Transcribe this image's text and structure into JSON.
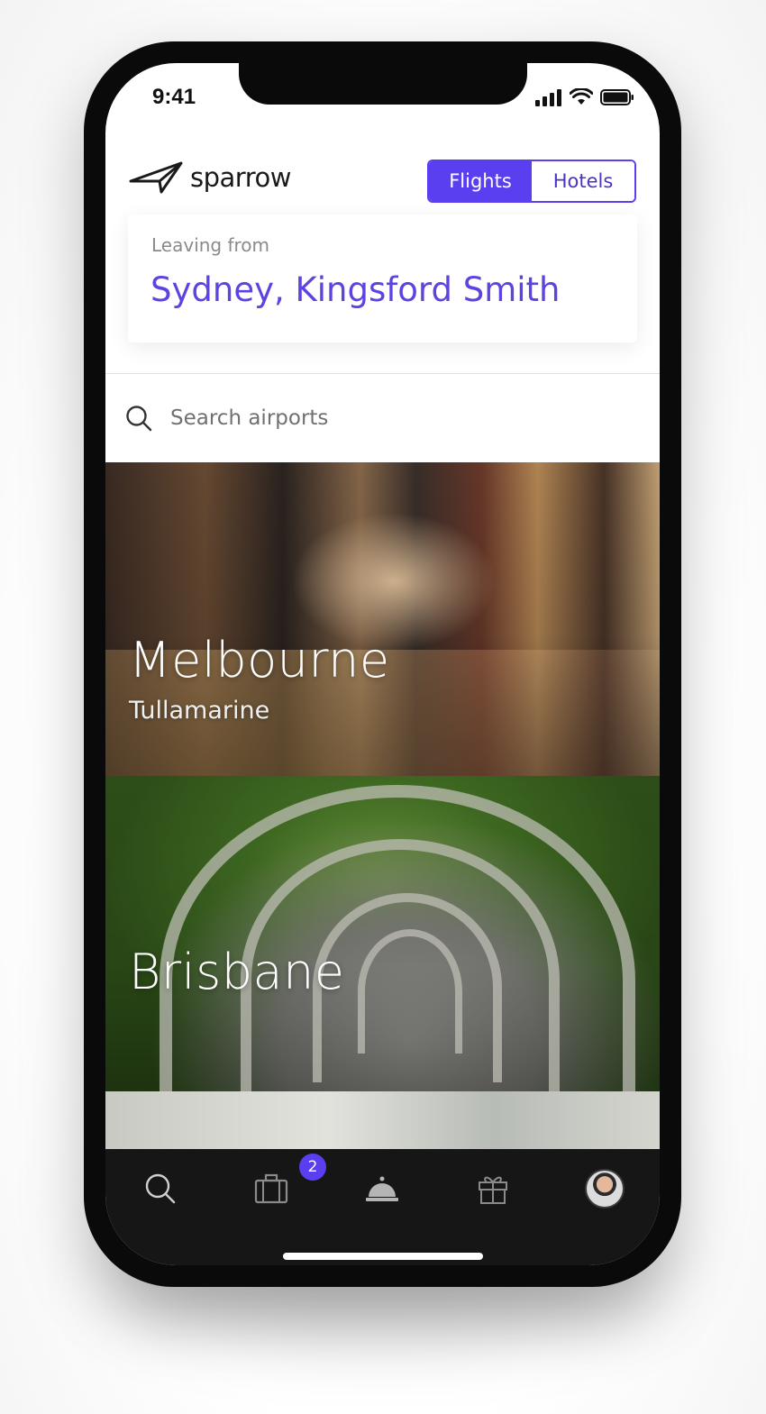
{
  "status_bar": {
    "time": "9:41"
  },
  "header": {
    "logo_text": "sparrow",
    "tabs": [
      {
        "label": "Flights",
        "active": true
      },
      {
        "label": "Hotels",
        "active": false
      }
    ]
  },
  "leaving": {
    "label": "Leaving from",
    "value": "Sydney, Kingsford Smith"
  },
  "search": {
    "placeholder": "Search airports"
  },
  "destinations": [
    {
      "city": "Melbourne",
      "airport": "Tullamarine"
    },
    {
      "city": "Brisbane",
      "airport": ""
    }
  ],
  "tabbar": {
    "items": [
      {
        "icon": "search-icon"
      },
      {
        "icon": "suitcase-icon",
        "badge": "2"
      },
      {
        "icon": "service-bell-icon"
      },
      {
        "icon": "gift-icon"
      },
      {
        "icon": "avatar"
      }
    ]
  },
  "colors": {
    "accent": "#5a3ff0",
    "accent_text": "#5b44e0",
    "tabbar_bg": "#161616"
  }
}
